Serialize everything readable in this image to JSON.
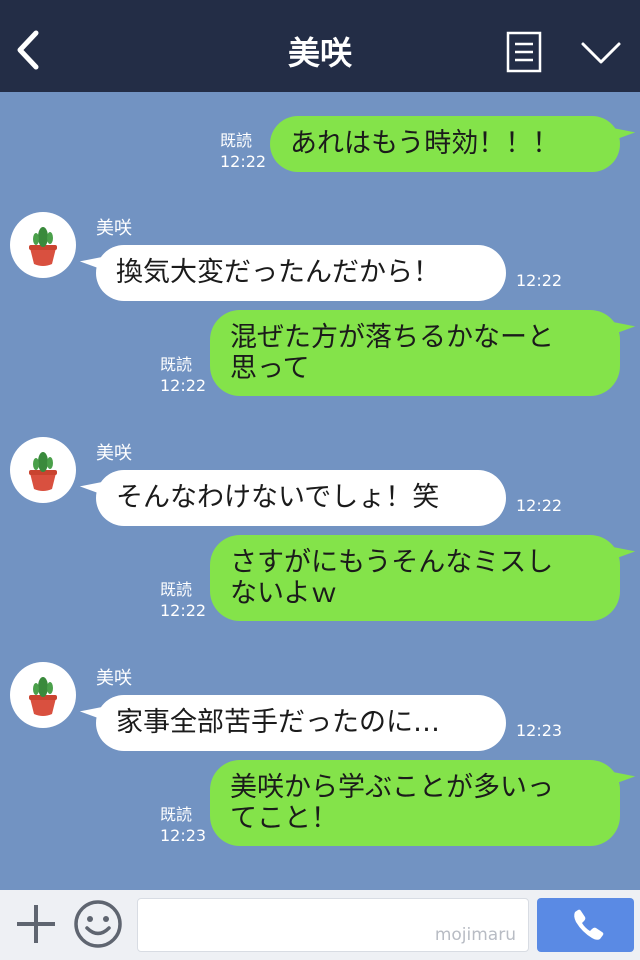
{
  "header": {
    "title": "美咲"
  },
  "contact": {
    "name": "美咲"
  },
  "messages": [
    {
      "side": "right",
      "text": "あれはもう時効！！！",
      "read": "既読",
      "time": "12:22"
    },
    {
      "side": "left",
      "text": "換気大変だったんだから！",
      "time": "12:22"
    },
    {
      "side": "right",
      "line1": "混ぜた方が落ちるかなーと",
      "line2": "思って",
      "read": "既読",
      "time": "12:22"
    },
    {
      "side": "left",
      "text": "そんなわけないでしょ！笑",
      "time": "12:22"
    },
    {
      "side": "right",
      "line1": "さすがにもうそんなミスし",
      "line2": "ないよｗ",
      "read": "既読",
      "time": "12:22"
    },
    {
      "side": "left",
      "text": "家事全部苦手だったのに…",
      "time": "12:23"
    },
    {
      "side": "right",
      "line1": "美咲から学ぶことが多いっ",
      "line2": "てこと！",
      "read": "既読",
      "time": "12:23"
    }
  ],
  "input": {
    "watermark": "mojimaru"
  },
  "colors": {
    "header_bg": "#232d46",
    "chat_bg": "#7293c2",
    "green_bubble": "#84e34a",
    "call_button": "#5a8ae4"
  },
  "icons": [
    "back-arrow-icon",
    "menu-list-icon",
    "chevron-down-icon",
    "plus-icon",
    "smile-icon",
    "phone-icon",
    "cactus-avatar"
  ]
}
